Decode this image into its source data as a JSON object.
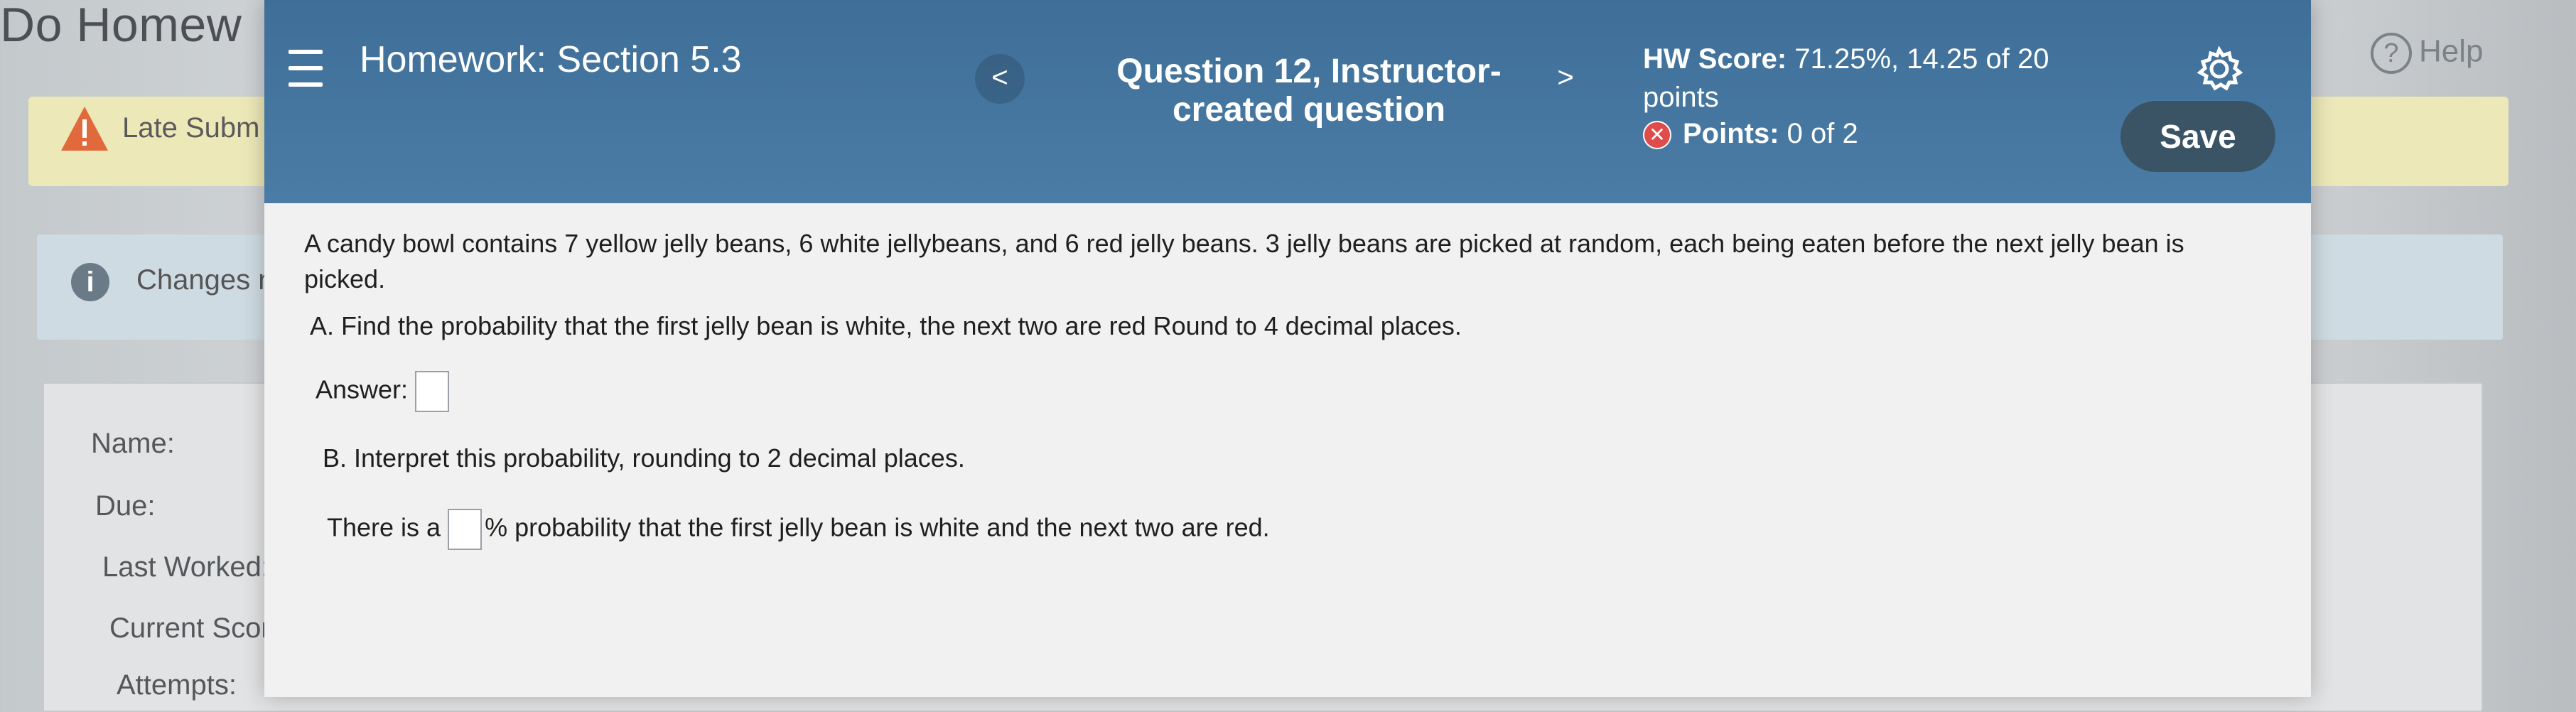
{
  "background": {
    "page_title": "Do Homew",
    "late_text": "Late Subm",
    "changes_text": "Changes n",
    "help_label": "Help",
    "fields": [
      "Name:",
      "Due:",
      "Last Worked:",
      "Current Score:",
      "Attempts:"
    ]
  },
  "header": {
    "hw_prefix": "Homework:",
    "hw_title": "Homework: Section 5.3",
    "prev_symbol": "<",
    "question_title": "Question 12, Instructor-created question",
    "next_symbol": ">",
    "score_label": "HW Score:",
    "score_value": "71.25%, 14.25 of 20 points",
    "points_label": "Points:",
    "points_value": "0 of 2",
    "save_label": "Save"
  },
  "question": {
    "problem_text": "A candy bowl contains 7 yellow jelly beans, 6 white jellybeans, and 6 red  jelly beans.  3 jelly beans are picked at random, each being eaten before the next jelly bean is picked.",
    "part_a": "A.  Find the probability that the first jelly bean is white, the next two are red  Round to 4 decimal places.",
    "answer_label": "Answer:",
    "part_b": "B.  Interpret this probability, rounding to 2 decimal places.",
    "sentence_before": "There is a",
    "sentence_after": "% probability that the first jelly bean is white and the next two are red."
  },
  "colors": {
    "header_blue": "#4a7ca6",
    "save_button": "#3a5466",
    "incorrect_red": "#e04b4b",
    "late_banner": "#ece8b8"
  },
  "icons": [
    "menu-icon",
    "chevron-left-icon",
    "chevron-right-icon",
    "settings-gear-icon",
    "incorrect-x-icon",
    "help-question-icon",
    "warning-icon",
    "info-icon"
  ]
}
